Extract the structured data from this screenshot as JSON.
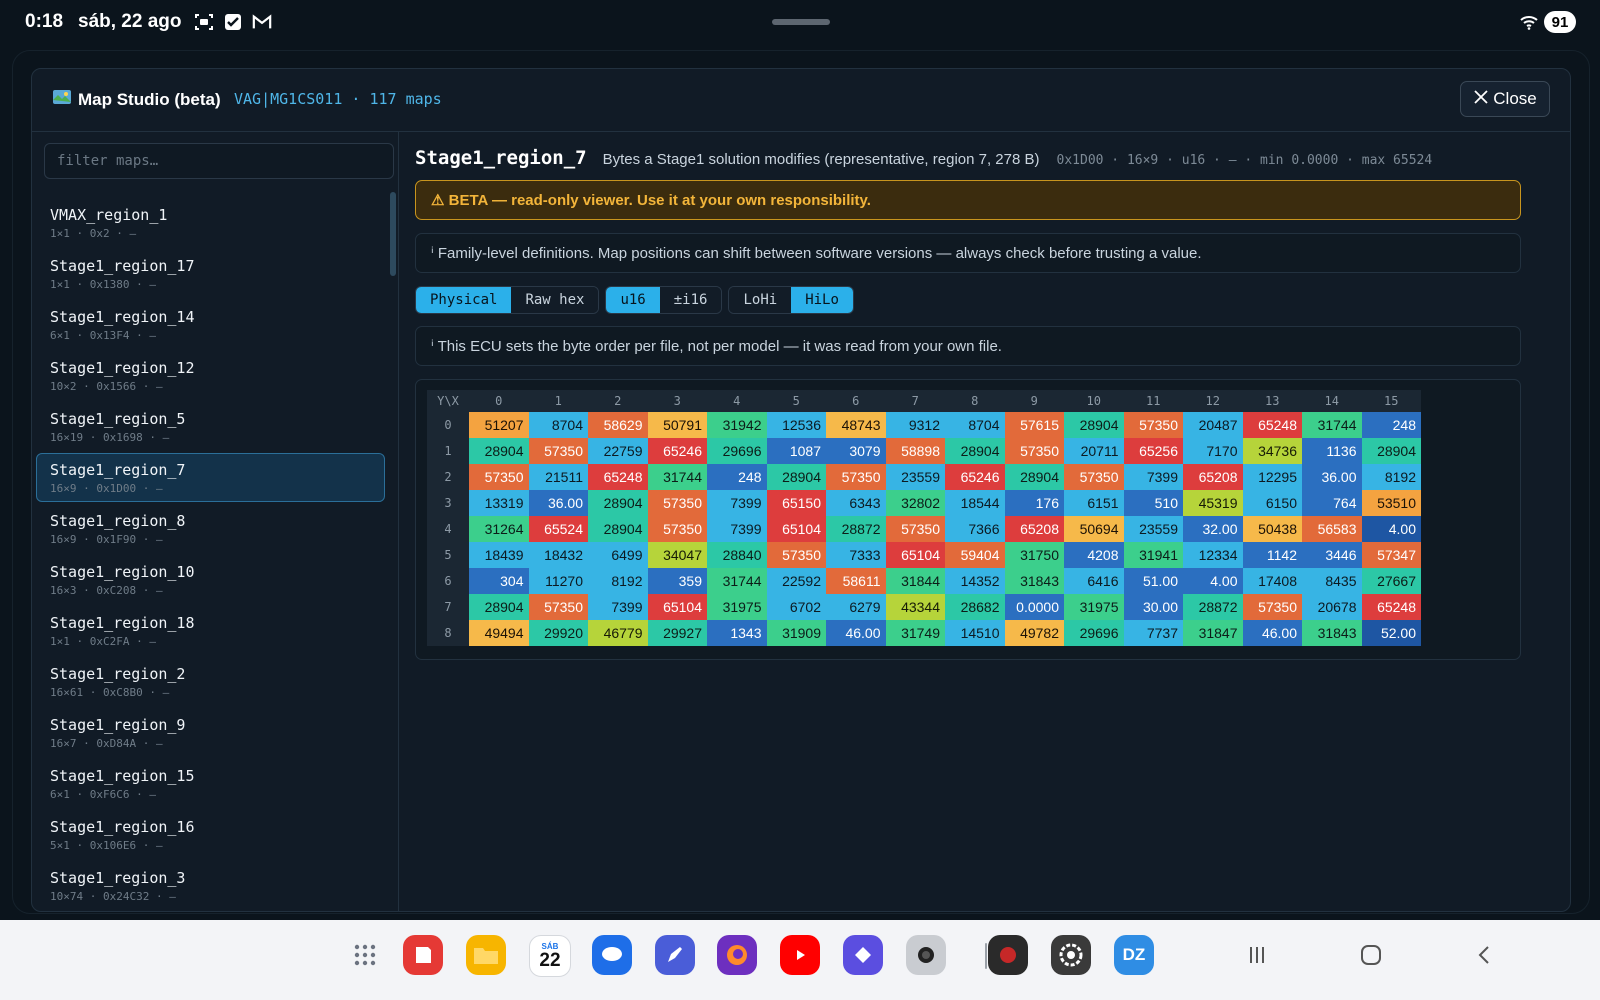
{
  "status_bar": {
    "time": "0:18",
    "date": "sáb, 22 ago",
    "icons": [
      "screenshot-icon",
      "checkbox-icon",
      "gmail-icon"
    ],
    "battery": "91"
  },
  "modal": {
    "title": "Map Studio (beta)",
    "title_icon": "map-icon",
    "subtitle": "VAG|MG1CS011 · 117 maps",
    "close_label": "Close"
  },
  "sidebar": {
    "filter_placeholder": "filter maps…",
    "items": [
      {
        "name": "VMAX_region_1",
        "meta": "1×1 · 0x2 · —"
      },
      {
        "name": "Stage1_region_17",
        "meta": "1×1 · 0x1380 · —"
      },
      {
        "name": "Stage1_region_14",
        "meta": "6×1 · 0x13F4 · —"
      },
      {
        "name": "Stage1_region_12",
        "meta": "10×2 · 0x1566 · —"
      },
      {
        "name": "Stage1_region_5",
        "meta": "16×19 · 0x1698 · —"
      },
      {
        "name": "Stage1_region_7",
        "meta": "16×9 · 0x1D00 · —",
        "selected": true
      },
      {
        "name": "Stage1_region_8",
        "meta": "16×9 · 0x1F90 · —"
      },
      {
        "name": "Stage1_region_10",
        "meta": "16×3 · 0xC208 · —"
      },
      {
        "name": "Stage1_region_18",
        "meta": "1×1 · 0xC2FA · —"
      },
      {
        "name": "Stage1_region_2",
        "meta": "16×61 · 0xC8B0 · —"
      },
      {
        "name": "Stage1_region_9",
        "meta": "16×7 · 0xD84A · —"
      },
      {
        "name": "Stage1_region_15",
        "meta": "6×1 · 0xF6C6 · —"
      },
      {
        "name": "Stage1_region_16",
        "meta": "5×1 · 0x106E6 · —"
      },
      {
        "name": "Stage1_region_3",
        "meta": "10×74 · 0x24C32 · —"
      }
    ]
  },
  "map": {
    "title": "Stage1_region_7",
    "description": "Bytes a Stage1 solution modifies (representative, region 7, 278 B)",
    "info": "0x1D00 · 16×9 · u16 · — · min 0.0000 · max 65524",
    "beta_warning": "⚠ BETA — read-only viewer. Use it at your own responsibility.",
    "family_note": "ⁱ Family-level definitions. Map positions can shift between software versions — always check before trusting a value.",
    "byteorder_note": "ⁱ This ECU sets the byte order per file, not per model — it was read from your own file."
  },
  "toolbar": {
    "groups": [
      [
        {
          "label": "Physical",
          "active": true
        },
        {
          "label": "Raw hex",
          "active": false
        }
      ],
      [
        {
          "label": "u16",
          "active": true
        },
        {
          "label": "±i16",
          "active": false
        }
      ],
      [
        {
          "label": "LoHi",
          "active": false
        },
        {
          "label": "HiLo",
          "active": true
        }
      ]
    ]
  },
  "table": {
    "corner": "Y\\X",
    "x_headers": [
      "0",
      "1",
      "2",
      "3",
      "4",
      "5",
      "6",
      "7",
      "8",
      "9",
      "10",
      "11",
      "12",
      "13",
      "14",
      "15"
    ],
    "rows": [
      {
        "y": "0",
        "cells": [
          {
            "v": "51207",
            "c": "orange"
          },
          {
            "v": "8704",
            "c": "cyan"
          },
          {
            "v": "58629",
            "c": "redorange"
          },
          {
            "v": "50791",
            "c": "amber"
          },
          {
            "v": "31942",
            "c": "green"
          },
          {
            "v": "12536",
            "c": "cyan"
          },
          {
            "v": "48743",
            "c": "amber"
          },
          {
            "v": "9312",
            "c": "cyan"
          },
          {
            "v": "8704",
            "c": "cyan"
          },
          {
            "v": "57615",
            "c": "redorange"
          },
          {
            "v": "28904",
            "c": "teal"
          },
          {
            "v": "57350",
            "c": "redorange"
          },
          {
            "v": "20487",
            "c": "cyan"
          },
          {
            "v": "65248",
            "c": "red"
          },
          {
            "v": "31744",
            "c": "green"
          },
          {
            "v": "248",
            "c": "blue"
          }
        ]
      },
      {
        "y": "1",
        "cells": [
          {
            "v": "28904",
            "c": "teal"
          },
          {
            "v": "57350",
            "c": "redorange"
          },
          {
            "v": "22759",
            "c": "cyan"
          },
          {
            "v": "65246",
            "c": "red"
          },
          {
            "v": "29696",
            "c": "teal"
          },
          {
            "v": "1087",
            "c": "blue"
          },
          {
            "v": "3079",
            "c": "blue"
          },
          {
            "v": "58898",
            "c": "redorange"
          },
          {
            "v": "28904",
            "c": "teal"
          },
          {
            "v": "57350",
            "c": "redorange"
          },
          {
            "v": "20711",
            "c": "cyan"
          },
          {
            "v": "65256",
            "c": "red"
          },
          {
            "v": "7170",
            "c": "cyan"
          },
          {
            "v": "34736",
            "c": "lime"
          },
          {
            "v": "1136",
            "c": "blue"
          },
          {
            "v": "28904",
            "c": "teal"
          }
        ]
      },
      {
        "y": "2",
        "cells": [
          {
            "v": "57350",
            "c": "redorange"
          },
          {
            "v": "21511",
            "c": "cyan"
          },
          {
            "v": "65248",
            "c": "red"
          },
          {
            "v": "31744",
            "c": "green"
          },
          {
            "v": "248",
            "c": "blue"
          },
          {
            "v": "28904",
            "c": "teal"
          },
          {
            "v": "57350",
            "c": "redorange"
          },
          {
            "v": "23559",
            "c": "cyan"
          },
          {
            "v": "65246",
            "c": "red"
          },
          {
            "v": "28904",
            "c": "teal"
          },
          {
            "v": "57350",
            "c": "redorange"
          },
          {
            "v": "7399",
            "c": "cyan"
          },
          {
            "v": "65208",
            "c": "red"
          },
          {
            "v": "12295",
            "c": "cyan"
          },
          {
            "v": "36.00",
            "c": "blue"
          },
          {
            "v": "8192",
            "c": "cyan"
          }
        ]
      },
      {
        "y": "3",
        "cells": [
          {
            "v": "13319",
            "c": "cyan"
          },
          {
            "v": "36.00",
            "c": "blue"
          },
          {
            "v": "28904",
            "c": "teal"
          },
          {
            "v": "57350",
            "c": "redorange"
          },
          {
            "v": "7399",
            "c": "cyan"
          },
          {
            "v": "65150",
            "c": "red"
          },
          {
            "v": "6343",
            "c": "cyan"
          },
          {
            "v": "32802",
            "c": "green"
          },
          {
            "v": "18544",
            "c": "cyan"
          },
          {
            "v": "176",
            "c": "blue"
          },
          {
            "v": "6151",
            "c": "cyan"
          },
          {
            "v": "510",
            "c": "blue"
          },
          {
            "v": "45319",
            "c": "lime"
          },
          {
            "v": "6150",
            "c": "cyan"
          },
          {
            "v": "764",
            "c": "blue"
          },
          {
            "v": "53510",
            "c": "orange"
          }
        ]
      },
      {
        "y": "4",
        "cells": [
          {
            "v": "31264",
            "c": "green"
          },
          {
            "v": "65524",
            "c": "red"
          },
          {
            "v": "28904",
            "c": "teal"
          },
          {
            "v": "57350",
            "c": "redorange"
          },
          {
            "v": "7399",
            "c": "cyan"
          },
          {
            "v": "65104",
            "c": "red"
          },
          {
            "v": "28872",
            "c": "teal"
          },
          {
            "v": "57350",
            "c": "redorange"
          },
          {
            "v": "7366",
            "c": "cyan"
          },
          {
            "v": "65208",
            "c": "red"
          },
          {
            "v": "50694",
            "c": "amber"
          },
          {
            "v": "23559",
            "c": "cyan"
          },
          {
            "v": "32.00",
            "c": "blue"
          },
          {
            "v": "50438",
            "c": "amber"
          },
          {
            "v": "56583",
            "c": "redorange"
          },
          {
            "v": "4.00",
            "c": "navy"
          }
        ]
      },
      {
        "y": "5",
        "cells": [
          {
            "v": "18439",
            "c": "cyan"
          },
          {
            "v": "18432",
            "c": "cyan"
          },
          {
            "v": "6499",
            "c": "cyan"
          },
          {
            "v": "34047",
            "c": "lime"
          },
          {
            "v": "28840",
            "c": "teal"
          },
          {
            "v": "57350",
            "c": "redorange"
          },
          {
            "v": "7333",
            "c": "cyan"
          },
          {
            "v": "65104",
            "c": "red"
          },
          {
            "v": "59404",
            "c": "redorange"
          },
          {
            "v": "31750",
            "c": "green"
          },
          {
            "v": "4208",
            "c": "blue"
          },
          {
            "v": "31941",
            "c": "green"
          },
          {
            "v": "12334",
            "c": "cyan"
          },
          {
            "v": "1142",
            "c": "blue"
          },
          {
            "v": "3446",
            "c": "blue"
          },
          {
            "v": "57347",
            "c": "redorange"
          }
        ]
      },
      {
        "y": "6",
        "cells": [
          {
            "v": "304",
            "c": "blue"
          },
          {
            "v": "11270",
            "c": "cyan"
          },
          {
            "v": "8192",
            "c": "cyan"
          },
          {
            "v": "359",
            "c": "blue"
          },
          {
            "v": "31744",
            "c": "green"
          },
          {
            "v": "22592",
            "c": "cyan"
          },
          {
            "v": "58611",
            "c": "redorange"
          },
          {
            "v": "31844",
            "c": "green"
          },
          {
            "v": "14352",
            "c": "cyan"
          },
          {
            "v": "31843",
            "c": "green"
          },
          {
            "v": "6416",
            "c": "cyan"
          },
          {
            "v": "51.00",
            "c": "blue"
          },
          {
            "v": "4.00",
            "c": "blue"
          },
          {
            "v": "17408",
            "c": "cyan"
          },
          {
            "v": "8435",
            "c": "cyan"
          },
          {
            "v": "27667",
            "c": "teal"
          }
        ]
      },
      {
        "y": "7",
        "cells": [
          {
            "v": "28904",
            "c": "teal"
          },
          {
            "v": "57350",
            "c": "redorange"
          },
          {
            "v": "7399",
            "c": "cyan"
          },
          {
            "v": "65104",
            "c": "red"
          },
          {
            "v": "31975",
            "c": "green"
          },
          {
            "v": "6702",
            "c": "cyan"
          },
          {
            "v": "6279",
            "c": "cyan"
          },
          {
            "v": "43344",
            "c": "lime"
          },
          {
            "v": "28682",
            "c": "teal"
          },
          {
            "v": "0.0000",
            "c": "blue"
          },
          {
            "v": "31975",
            "c": "green"
          },
          {
            "v": "30.00",
            "c": "blue"
          },
          {
            "v": "28872",
            "c": "teal"
          },
          {
            "v": "57350",
            "c": "redorange"
          },
          {
            "v": "20678",
            "c": "cyan"
          },
          {
            "v": "65248",
            "c": "red"
          }
        ]
      },
      {
        "y": "8",
        "cells": [
          {
            "v": "49494",
            "c": "amber"
          },
          {
            "v": "29920",
            "c": "teal"
          },
          {
            "v": "46779",
            "c": "lime"
          },
          {
            "v": "29927",
            "c": "teal"
          },
          {
            "v": "1343",
            "c": "blue"
          },
          {
            "v": "31909",
            "c": "green"
          },
          {
            "v": "46.00",
            "c": "blue"
          },
          {
            "v": "31749",
            "c": "green"
          },
          {
            "v": "14510",
            "c": "cyan"
          },
          {
            "v": "49782",
            "c": "amber"
          },
          {
            "v": "29696",
            "c": "teal"
          },
          {
            "v": "7737",
            "c": "cyan"
          },
          {
            "v": "31847",
            "c": "green"
          },
          {
            "v": "46.00",
            "c": "blue"
          },
          {
            "v": "31843",
            "c": "green"
          },
          {
            "v": "52.00",
            "c": "navy"
          }
        ]
      }
    ]
  },
  "dock": {
    "apps": [
      {
        "name": "app-drawer-icon",
        "color": "#6b7280"
      },
      {
        "name": "flexcil-icon",
        "color": "#e53935"
      },
      {
        "name": "files-icon",
        "color": "#f7b500"
      },
      {
        "name": "calendar-icon",
        "color": "#ffffff",
        "label_top": "SÁB",
        "label": "22"
      },
      {
        "name": "messages-icon",
        "color": "#1e6ee8"
      },
      {
        "name": "notes-pen-icon",
        "color": "#4a5dd8"
      },
      {
        "name": "firefox-icon",
        "color": "#6d2fbf"
      },
      {
        "name": "youtube-icon",
        "color": "#ff0000"
      },
      {
        "name": "play-app-icon",
        "color": "#5b4ee0"
      },
      {
        "name": "camera-icon",
        "color": "#c9ccd1"
      },
      {
        "name": "davinci-icon",
        "color": "#2a2a2a"
      },
      {
        "name": "settings-icon",
        "color": "#3a3a3a"
      },
      {
        "name": "dz-app-icon",
        "color": "#2f8de4",
        "label": "DZ"
      }
    ]
  },
  "nav": {
    "recents": "recents-icon",
    "home": "home-icon",
    "back": "back-icon"
  }
}
